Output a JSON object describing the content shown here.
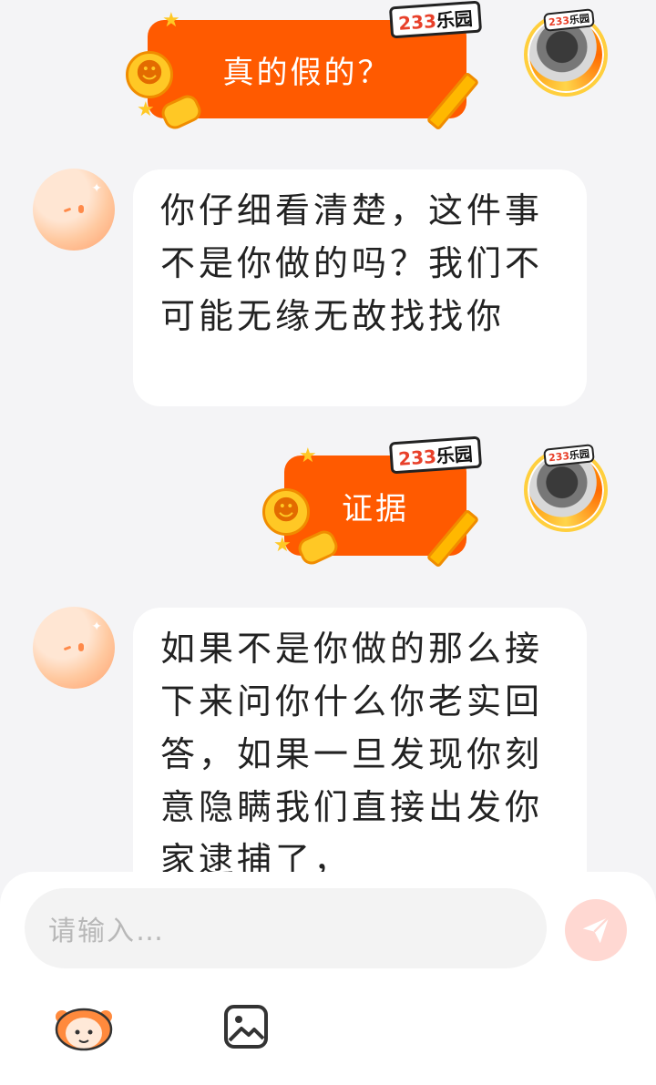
{
  "messages": [
    {
      "role": "user",
      "text": "真的假的？"
    },
    {
      "role": "assistant",
      "text": "你仔细看清楚，这件事不是你做的吗？我们不可能无缘无故找找你"
    },
    {
      "role": "user",
      "text": "证据"
    },
    {
      "role": "assistant",
      "text": "如果不是你做的那么接下来问你什么你老实回答，如果一旦发现你刻意隐瞒我们直接出发你家逮捕了，"
    }
  ],
  "sticker": {
    "brand_num": "233",
    "brand_txt": "乐园"
  },
  "input": {
    "placeholder": "请输入…"
  },
  "colors": {
    "accent": "#ff5a00",
    "send_button": "#ffd8d2",
    "background": "#f4f4f6"
  }
}
